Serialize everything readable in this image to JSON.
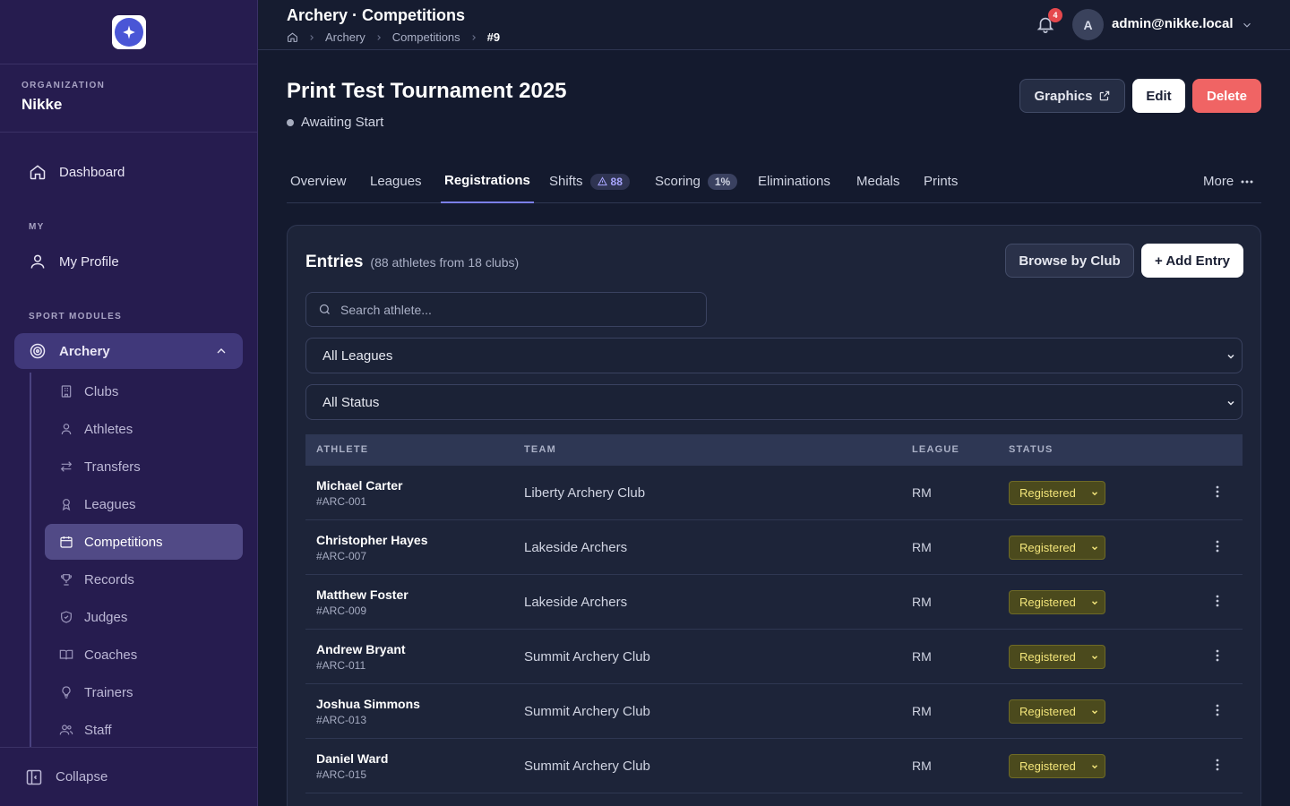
{
  "org": {
    "label": "ORGANIZATION",
    "name": "Nikke"
  },
  "nav": {
    "dashboard": "Dashboard",
    "my_label": "MY",
    "my_profile": "My Profile",
    "sport_label": "SPORT MODULES",
    "archery": "Archery",
    "sub": [
      "Clubs",
      "Athletes",
      "Transfers",
      "Leagues",
      "Competitions",
      "Records",
      "Judges",
      "Coaches",
      "Trainers",
      "Staff"
    ],
    "collapse": "Collapse"
  },
  "topbar": {
    "title": "Archery · Competitions",
    "crumbs": [
      "Archery",
      "Competitions",
      "#9"
    ],
    "notifications": "4",
    "avatar_initial": "A",
    "user": "admin@nikke.local"
  },
  "page": {
    "title": "Print Test Tournament 2025",
    "status": "Awaiting Start",
    "graphics": "Graphics",
    "edit": "Edit",
    "delete": "Delete"
  },
  "tabs": {
    "overview": "Overview",
    "leagues": "Leagues",
    "registrations": "Registrations",
    "shifts": "Shifts",
    "shifts_badge": "88",
    "scoring": "Scoring",
    "scoring_badge": "1%",
    "eliminations": "Eliminations",
    "medals": "Medals",
    "prints": "Prints",
    "more": "More"
  },
  "entries": {
    "title": "Entries",
    "subtitle": "(88 athletes from 18 clubs)",
    "browse": "Browse by Club",
    "add": "+ Add Entry",
    "search_placeholder": "Search athlete...",
    "league_filter": "All Leagues",
    "status_filter": "All Status",
    "columns": {
      "athlete": "ATHLETE",
      "team": "TEAM",
      "league": "LEAGUE",
      "status": "STATUS"
    },
    "rows": [
      {
        "name": "Michael Carter",
        "code": "#ARC-001",
        "team": "Liberty Archery Club",
        "league": "RM",
        "status": "Registered"
      },
      {
        "name": "Christopher Hayes",
        "code": "#ARC-007",
        "team": "Lakeside Archers",
        "league": "RM",
        "status": "Registered"
      },
      {
        "name": "Matthew Foster",
        "code": "#ARC-009",
        "team": "Lakeside Archers",
        "league": "RM",
        "status": "Registered"
      },
      {
        "name": "Andrew Bryant",
        "code": "#ARC-011",
        "team": "Summit Archery Club",
        "league": "RM",
        "status": "Registered"
      },
      {
        "name": "Joshua Simmons",
        "code": "#ARC-013",
        "team": "Summit Archery Club",
        "league": "RM",
        "status": "Registered"
      },
      {
        "name": "Daniel Ward",
        "code": "#ARC-015",
        "team": "Summit Archery Club",
        "league": "RM",
        "status": "Registered"
      }
    ]
  },
  "colors": {
    "sidebar": "#261c4f",
    "accent": "#7b7fe8",
    "danger": "#f06464",
    "registered": "#4b4a1d"
  }
}
